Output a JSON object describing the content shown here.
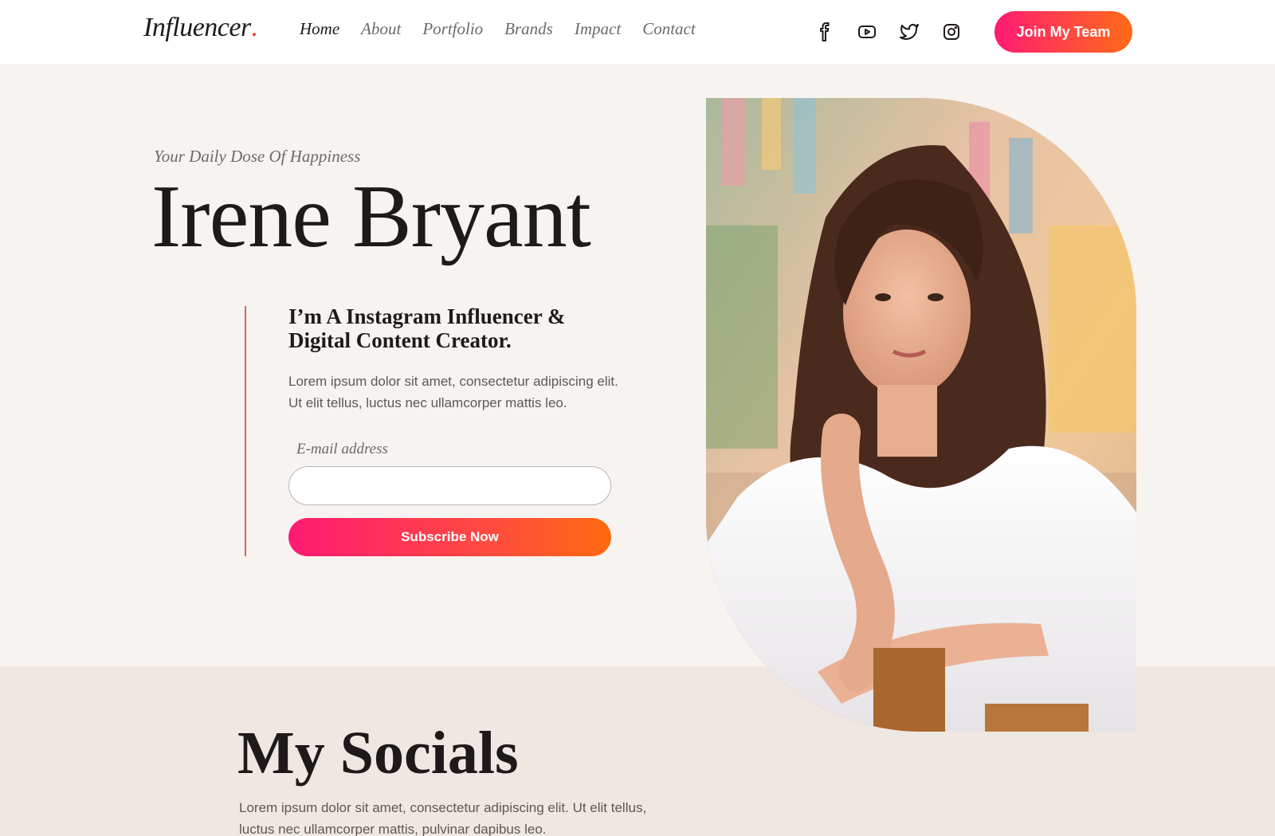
{
  "header": {
    "logo_text": "Influencer",
    "logo_dot": ".",
    "nav": [
      {
        "label": "Home",
        "active": true
      },
      {
        "label": "About",
        "active": false
      },
      {
        "label": "Portfolio",
        "active": false
      },
      {
        "label": "Brands",
        "active": false
      },
      {
        "label": "Impact",
        "active": false
      },
      {
        "label": "Contact",
        "active": false
      }
    ],
    "social_icons": [
      "facebook-icon",
      "youtube-icon",
      "twitter-icon",
      "instagram-icon"
    ],
    "join_label": "Join My Team"
  },
  "hero": {
    "tagline": "Your Daily Dose Of Happiness",
    "name": "Irene Bryant",
    "intro_title": "I’m A Instagram Influencer & Digital Content Creator.",
    "intro_text": "Lorem ipsum dolor sit amet, consectetur adipiscing elit. Ut elit tellus, luctus nec ullamcorper mattis leo.",
    "email_label": "E-mail address",
    "email_value": "",
    "subscribe_label": "Subscribe Now"
  },
  "socials_section": {
    "title": "My Socials",
    "text": "Lorem ipsum dolor sit amet, consectetur adipiscing elit. Ut elit tellus, luctus nec ullamcorper mattis, pulvinar dapibus leo."
  },
  "colors": {
    "accent_start": "#ff1a72",
    "accent_end": "#ff6a17",
    "accent_line": "#c96f57",
    "background": "#f6f3f1",
    "section_background": "#efe7e2"
  }
}
